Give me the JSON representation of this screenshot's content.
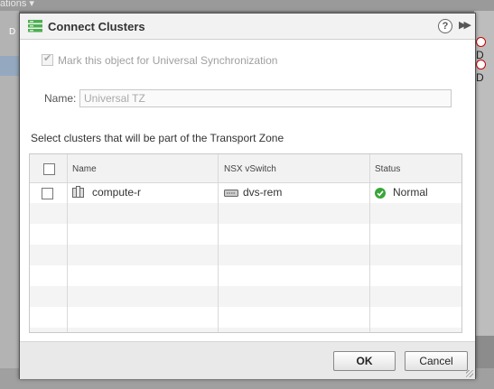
{
  "background": {
    "top_text": "ations ▾",
    "left_text": "D",
    "right_items": [
      "D",
      "D"
    ]
  },
  "dialog": {
    "title": "Connect Clusters",
    "help_symbol": "?",
    "expand_symbol": "▶▶",
    "sync_label": "Mark this object for Universal Synchronization",
    "sync_checked": true,
    "sync_disabled": true,
    "name_label": "Name:",
    "name_value": "Universal TZ",
    "instruction": "Select clusters that will be part of the Transport Zone",
    "table": {
      "columns": [
        "Name",
        "NSX vSwitch",
        "Status"
      ],
      "rows": [
        {
          "name": "compute-r",
          "vswitch": "dvs-rem",
          "status": "Normal",
          "checked": false
        }
      ]
    },
    "ok_label": "OK",
    "cancel_label": "Cancel"
  },
  "colors": {
    "status_ok": "#3aa53a",
    "error": "#cc0000"
  },
  "icons": [
    "cluster-icon",
    "help-icon",
    "expand-icon",
    "host-cluster-icon",
    "vswitch-icon",
    "status-ok-icon"
  ]
}
